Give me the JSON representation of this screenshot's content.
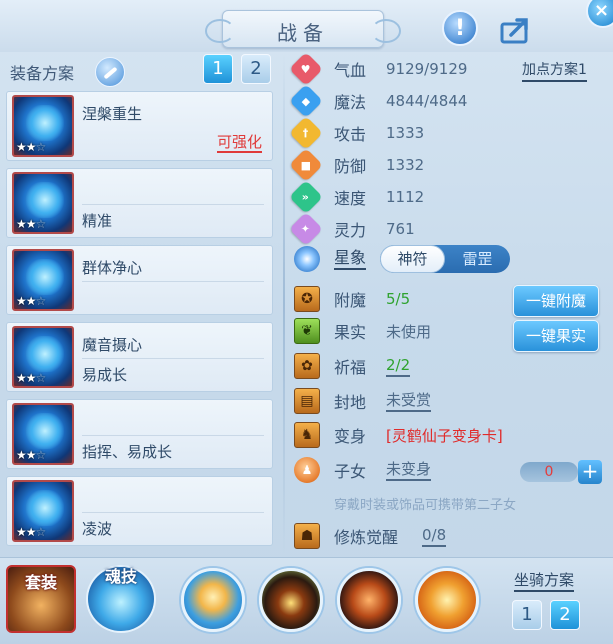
{
  "header": {
    "title": "战备"
  },
  "left": {
    "section_label": "装备方案",
    "plan_tabs": [
      "1",
      "2"
    ],
    "cards": [
      {
        "line1": "涅槃重生",
        "line2": "",
        "enhance": "可强化"
      },
      {
        "line1": "",
        "line2": "精准"
      },
      {
        "line1": "群体净心",
        "line2": ""
      },
      {
        "line1": "魔音摄心",
        "line2": "易成长"
      },
      {
        "line1": "",
        "line2": "指挥、易成长"
      },
      {
        "line1": "",
        "line2": "凌波"
      }
    ],
    "stars_filled": "★★",
    "stars_empty": "☆"
  },
  "stats": [
    {
      "label": "气血",
      "value": "9129/9129",
      "color": "#e85a6a",
      "icon": "heart-icon"
    },
    {
      "label": "魔法",
      "value": "4844/4844",
      "color": "#3aa0f0",
      "icon": "mana-icon"
    },
    {
      "label": "攻击",
      "value": "1333",
      "color": "#f2b830",
      "icon": "sword-icon"
    },
    {
      "label": "防御",
      "value": "1332",
      "color": "#f08a3a",
      "icon": "shield-icon"
    },
    {
      "label": "速度",
      "value": "1112",
      "color": "#2ec48a",
      "icon": "speed-icon"
    },
    {
      "label": "灵力",
      "value": "761",
      "color": "#c78ae6",
      "icon": "spirit-icon"
    }
  ],
  "add_point_label": "加点方案1",
  "star": {
    "label": "星象",
    "options": [
      "神符",
      "雷罡"
    ],
    "selected": 0
  },
  "rows": {
    "enchant": {
      "label": "附魔",
      "value": "5/5",
      "button": "一键附魔"
    },
    "fruit": {
      "label": "果实",
      "value": "未使用",
      "button": "一键果实"
    },
    "bless": {
      "label": "祈福",
      "value": "2/2"
    },
    "fief": {
      "label": "封地",
      "value": "未受赏"
    },
    "transform": {
      "label": "变身",
      "value": "[灵鹤仙子变身卡]"
    },
    "child": {
      "label": "子女",
      "value": "未变身",
      "count": "0",
      "plus": "+"
    },
    "hint": "穿戴时装或饰品可携带第二子女",
    "awaken": {
      "label": "修炼觉醒",
      "value": "0/8"
    }
  },
  "bottom": {
    "suit_label": "套装",
    "soul_label": "魂技",
    "mount_label": "坐骑方案",
    "mount_tabs": [
      "1",
      "2"
    ]
  }
}
